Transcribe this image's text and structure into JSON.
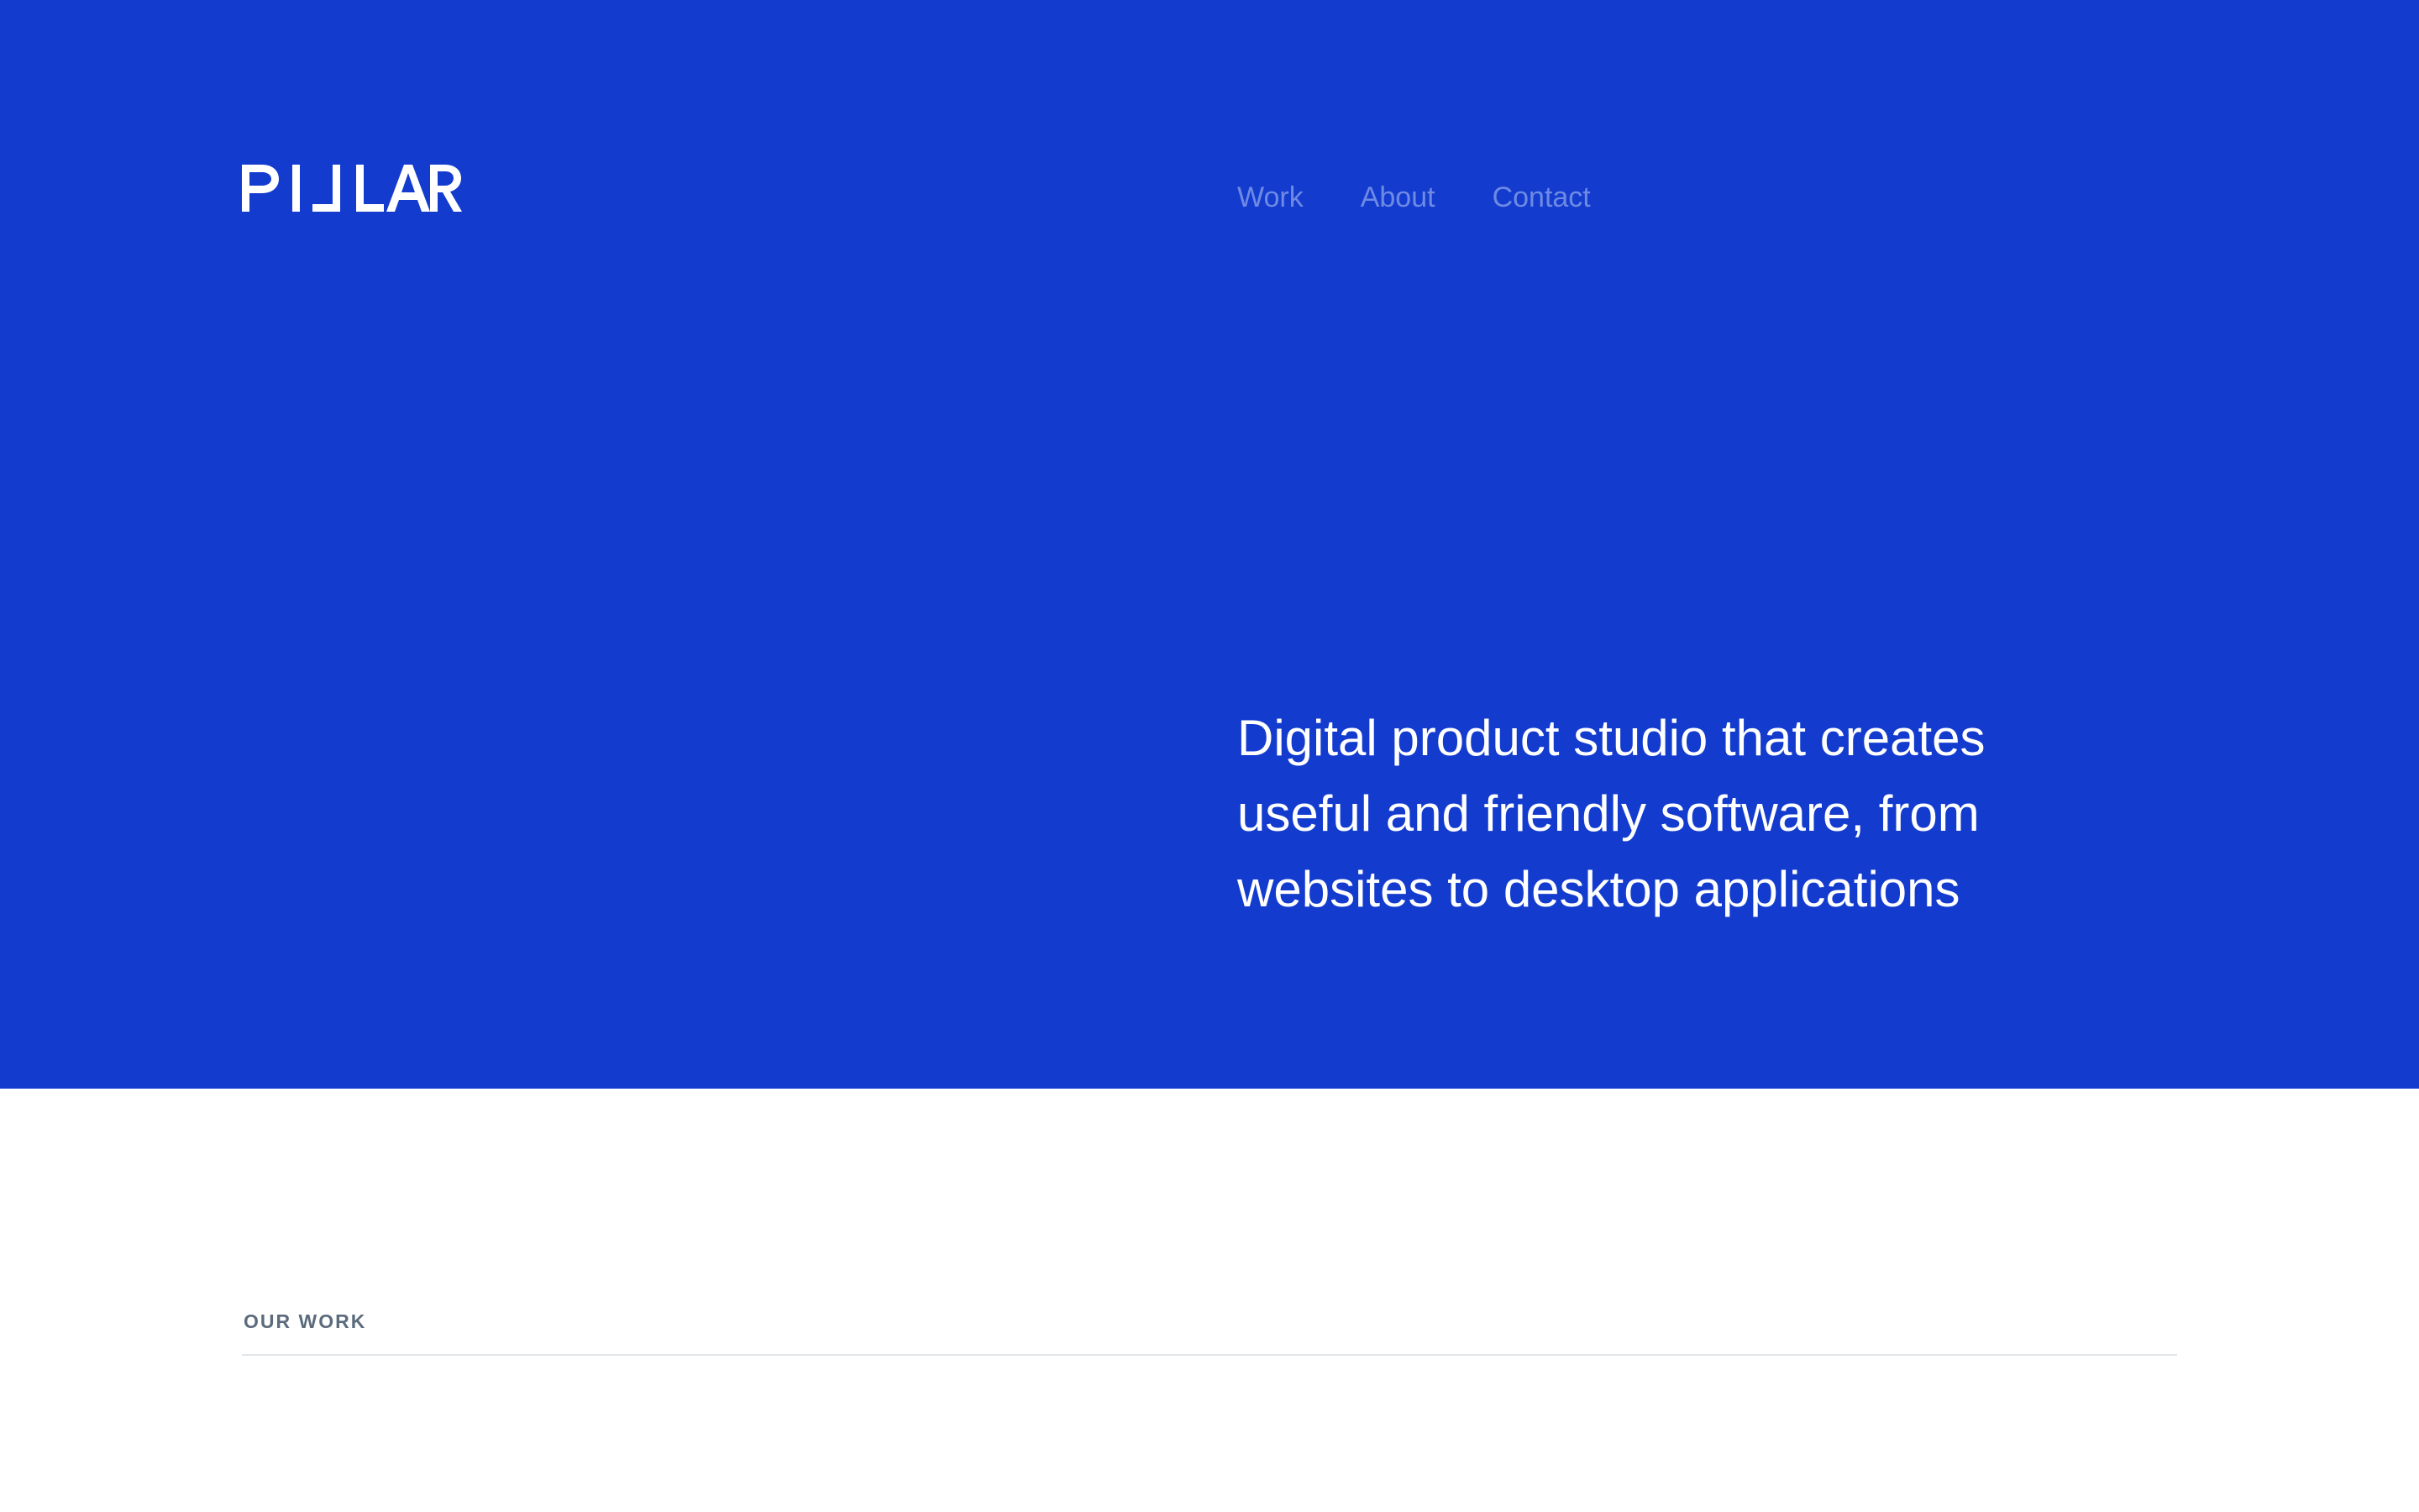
{
  "brand": {
    "logo_text": "PILLAR",
    "logo_icon": "pillar-wordmark"
  },
  "nav": {
    "items": [
      {
        "label": "Work"
      },
      {
        "label": "About"
      },
      {
        "label": "Contact"
      }
    ]
  },
  "hero": {
    "tagline_lines": [
      "Digital product studio that creates",
      "useful and friendly software, from",
      "websites to desktop applications"
    ]
  },
  "work": {
    "section_label": "OUR WORK"
  },
  "colors": {
    "hero_background": "#133ccf",
    "nav_link": "#6f8ae3",
    "tagline_text": "#ffffff",
    "section_label": "#5b6b7c",
    "divider": "#e3e6ea"
  }
}
